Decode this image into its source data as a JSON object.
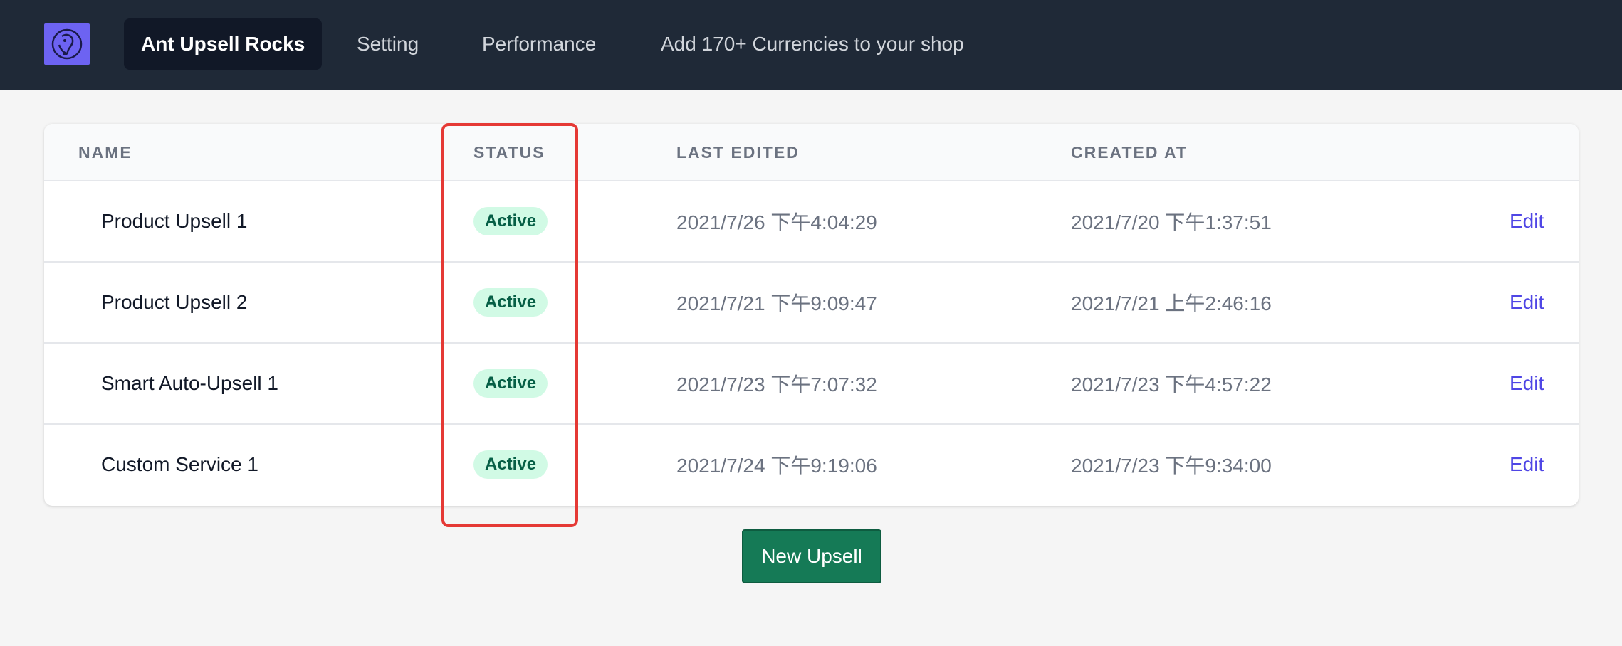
{
  "nav": {
    "logo_icon": "elephant-logo-icon",
    "items": [
      {
        "label": "Ant Upsell Rocks",
        "active": true
      },
      {
        "label": "Setting",
        "active": false
      },
      {
        "label": "Performance",
        "active": false
      },
      {
        "label": "Add 170+ Currencies to your shop",
        "active": false
      }
    ]
  },
  "table": {
    "columns": [
      "NAME",
      "STATUS",
      "LAST EDITED",
      "CREATED AT"
    ],
    "rows": [
      {
        "name": "Product Upsell 1",
        "status": "Active",
        "last_edited": "2021/7/26 下午4:04:29",
        "created_at": "2021/7/20 下午1:37:51",
        "action": "Edit"
      },
      {
        "name": "Product Upsell 2",
        "status": "Active",
        "last_edited": "2021/7/21 下午9:09:47",
        "created_at": "2021/7/21 上午2:46:16",
        "action": "Edit"
      },
      {
        "name": "Smart Auto-Upsell 1",
        "status": "Active",
        "last_edited": "2021/7/23 下午7:07:32",
        "created_at": "2021/7/23 下午4:57:22",
        "action": "Edit"
      },
      {
        "name": "Custom Service 1",
        "status": "Active",
        "last_edited": "2021/7/24 下午9:19:06",
        "created_at": "2021/7/23 下午9:34:00",
        "action": "Edit"
      }
    ]
  },
  "actions": {
    "new_upsell_label": "New Upsell"
  },
  "colors": {
    "nav_bg": "#1f2937",
    "active_badge_bg": "#d1fae5",
    "active_badge_text": "#065f46",
    "edit_link": "#4f46e5",
    "primary_button": "#157a56",
    "highlight_border": "#e53935"
  }
}
